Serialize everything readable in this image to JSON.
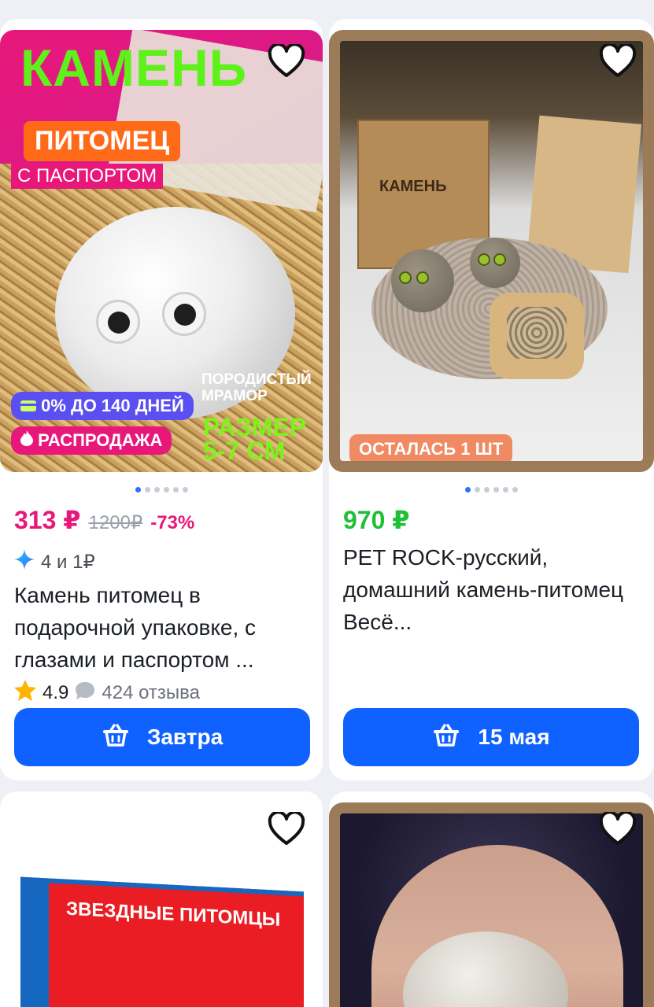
{
  "colors": {
    "accent_blue": "#0f62ff",
    "price_pink": "#e8187a",
    "price_green": "#1fbf38",
    "old_price_gray": "#9aa0ab",
    "page_bg": "#eef0f5"
  },
  "icons": {
    "favorite": "heart-icon",
    "installment": "sparkle-icon",
    "rating": "star-icon",
    "reviews": "speech-bubble-icon",
    "delivery": "basket-icon",
    "credit": "card-icon",
    "sale": "flame-icon"
  },
  "products": [
    {
      "image": {
        "title_big": "КАМЕНЬ",
        "title_pill": "ПИТОМЕЦ",
        "title_sub": "С ПАСПОРТОМ",
        "note_line1": "ПОРОДИСТЫЙ",
        "note_line2": "МРАМОР",
        "size_line1": "РАЗМЕР",
        "size_line2": "5-7 СМ",
        "badge_credit": "0% ДО 140 ДНЕЙ",
        "badge_sale": "РАСПРОДАЖА"
      },
      "carousel": {
        "current": 1,
        "total": 6
      },
      "price": "313 ₽",
      "old_price": "1200₽",
      "discount": "-73%",
      "installment": "4 и 1₽",
      "name": "Камень питомец в подарочной упаковке, с глазами и паспортом ...",
      "rating": "4.9",
      "reviews": "424 отзыва",
      "delivery": "Завтра"
    },
    {
      "image": {
        "box_label": "КАМЕНЬ",
        "badge_left": "ОСТАЛАСЬ 1 ШТ"
      },
      "carousel": {
        "current": 1,
        "total": 6
      },
      "price": "970 ₽",
      "name": "PET ROCK-русский, домашний камень-питомец Весё...",
      "delivery": "15 мая"
    },
    {
      "image": {
        "box_title": "ЗВЕЗДНЫЕ ПИТОМЦЫ"
      }
    },
    {
      "image": {}
    }
  ]
}
